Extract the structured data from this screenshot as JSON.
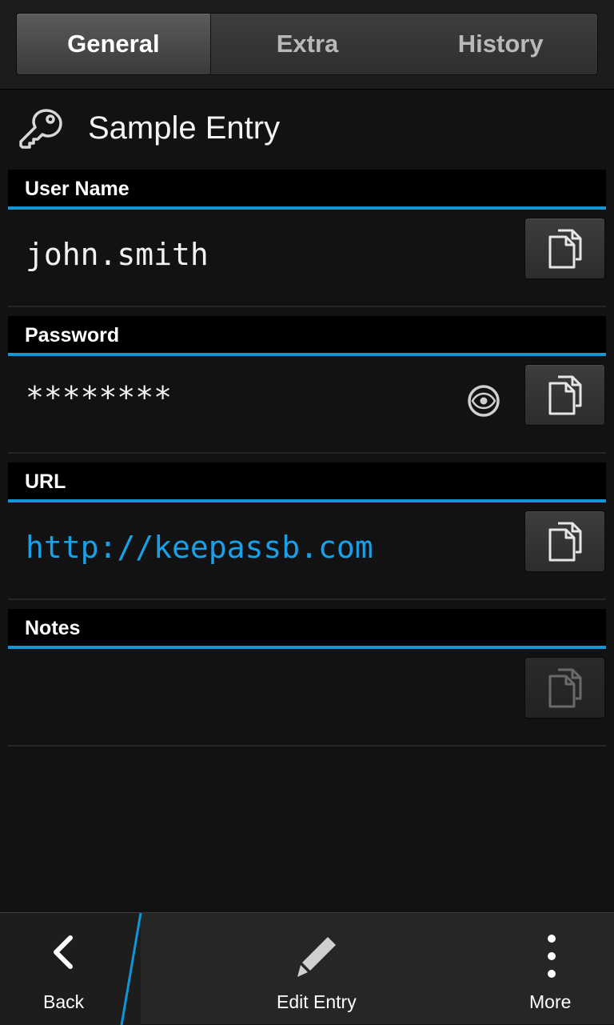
{
  "tabs": [
    {
      "label": "General",
      "active": true
    },
    {
      "label": "Extra",
      "active": false
    },
    {
      "label": "History",
      "active": false
    }
  ],
  "entry": {
    "title": "Sample Entry",
    "icon": "key-icon"
  },
  "fields": {
    "username": {
      "label": "User Name",
      "value": "john.smith"
    },
    "password": {
      "label": "Password",
      "value": "********"
    },
    "url": {
      "label": "URL",
      "value": "http://keepassb.com"
    },
    "notes": {
      "label": "Notes",
      "value": ""
    }
  },
  "actions": {
    "back": "Back",
    "edit": "Edit Entry",
    "more": "More"
  },
  "colors": {
    "accent": "#0f96d6",
    "link": "#19a0e6",
    "background": "#121212"
  }
}
